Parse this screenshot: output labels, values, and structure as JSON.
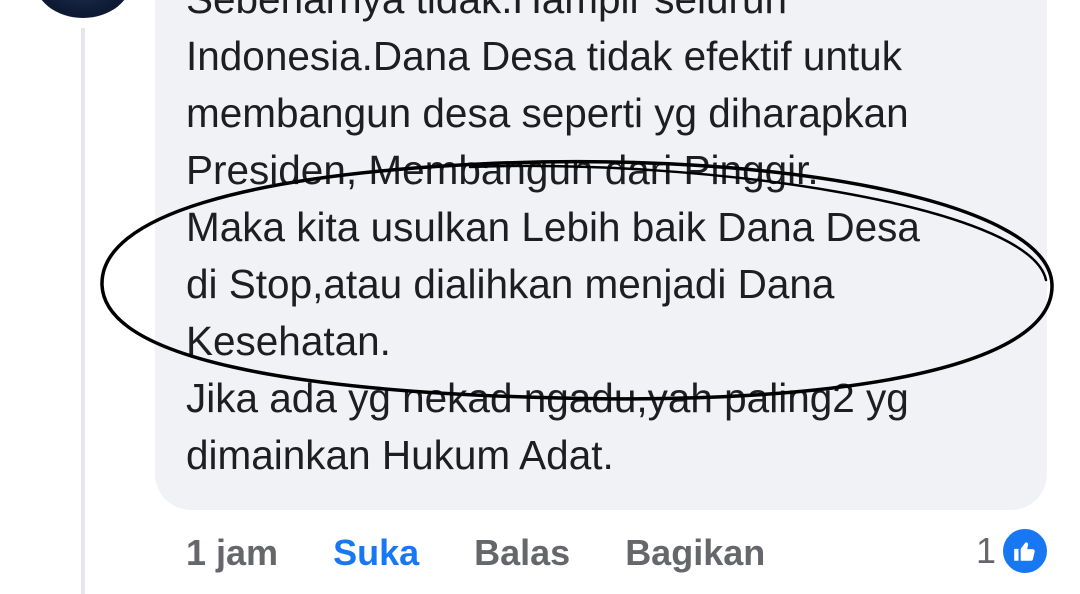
{
  "comment": {
    "text_lines": [
      "Sebenarnya tidak.Hampir seluruh",
      "Indonesia.Dana Desa tidak efektif untuk",
      "membangun desa seperti yg diharapkan",
      "Presiden, Membangun dari Pinggir.",
      "Maka kita usulkan Lebih baik Dana Desa",
      "di Stop,atau dialihkan menjadi Dana",
      "Kesehatan.",
      "Jika ada yg nekad ngadu,yah paling2 yg",
      "dimainkan Hukum Adat."
    ]
  },
  "actions": {
    "timestamp": "1 jam",
    "like_label": "Suka",
    "reply_label": "Balas",
    "share_label": "Bagikan"
  },
  "reactions": {
    "count": "1",
    "icon": "thumbs-up-icon",
    "color": "#1877f2"
  },
  "annotation": {
    "shape": "hand-drawn ellipse",
    "color": "#000000"
  }
}
